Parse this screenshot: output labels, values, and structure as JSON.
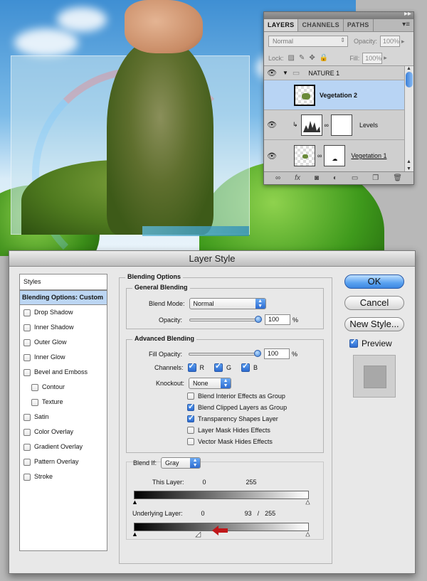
{
  "layers_panel": {
    "tabs": [
      "LAYERS",
      "CHANNELS",
      "PATHS"
    ],
    "blend_mode": "Normal",
    "opacity_label": "Opacity:",
    "opacity_value": "100%",
    "lock_label": "Lock:",
    "fill_label": "Fill:",
    "fill_value": "100%",
    "layers": [
      {
        "name": "NATURE 1",
        "type": "group"
      },
      {
        "name": "Vegetation 2",
        "type": "layer",
        "selected": true
      },
      {
        "name": "Levels",
        "type": "adjustment"
      },
      {
        "name": "Vegetation 1",
        "type": "layer"
      }
    ]
  },
  "dialog": {
    "title": "Layer Style",
    "styles_header": "Styles",
    "styles": [
      {
        "label": "Blending Options: Custom",
        "selected": true
      },
      {
        "label": "Drop Shadow"
      },
      {
        "label": "Inner Shadow"
      },
      {
        "label": "Outer Glow"
      },
      {
        "label": "Inner Glow"
      },
      {
        "label": "Bevel and Emboss"
      },
      {
        "label": "Contour",
        "indent": true
      },
      {
        "label": "Texture",
        "indent": true
      },
      {
        "label": "Satin"
      },
      {
        "label": "Color Overlay"
      },
      {
        "label": "Gradient Overlay"
      },
      {
        "label": "Pattern Overlay"
      },
      {
        "label": "Stroke"
      }
    ],
    "blending_options_title": "Blending Options",
    "general_blending_title": "General Blending",
    "blend_mode_label": "Blend Mode:",
    "blend_mode_value": "Normal",
    "opacity_label": "Opacity:",
    "opacity_value": "100",
    "percent": "%",
    "advanced_blending_title": "Advanced Blending",
    "fill_opacity_label": "Fill Opacity:",
    "fill_opacity_value": "100",
    "channels_label": "Channels:",
    "channels": [
      "R",
      "G",
      "B"
    ],
    "knockout_label": "Knockout:",
    "knockout_value": "None",
    "advanced_checkboxes": [
      {
        "label": "Blend Interior Effects as Group",
        "checked": false
      },
      {
        "label": "Blend Clipped Layers as Group",
        "checked": true
      },
      {
        "label": "Transparency Shapes Layer",
        "checked": true
      },
      {
        "label": "Layer Mask Hides Effects",
        "checked": false
      },
      {
        "label": "Vector Mask Hides Effects",
        "checked": false
      }
    ],
    "blend_if_label": "Blend If:",
    "blend_if_value": "Gray",
    "this_layer_label": "This Layer:",
    "this_layer_black": "0",
    "this_layer_white": "255",
    "underlying_label": "Underlying Layer:",
    "underlying_black": "0",
    "underlying_split_low": "93",
    "underlying_slash": "/",
    "underlying_white": "255",
    "buttons": {
      "ok": "OK",
      "cancel": "Cancel",
      "new_style": "New Style..."
    },
    "preview_label": "Preview",
    "accent_color": "#3d86e0",
    "arrow_color": "#c0171a"
  }
}
